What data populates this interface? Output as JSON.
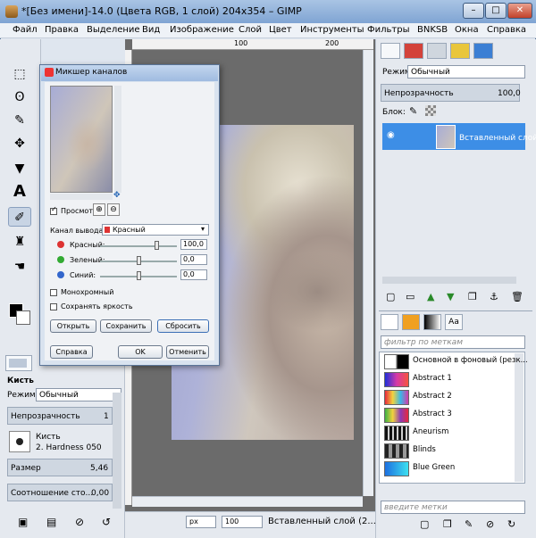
{
  "window": {
    "title": "*[Без имени]-14.0 (Цвета RGB, 1 слой) 204x354 – GIMP",
    "min": "–",
    "max": "□",
    "close": "✕"
  },
  "menu": [
    "Файл",
    "Правка",
    "Выделение",
    "Вид",
    "Изображение",
    "Слой",
    "Цвет",
    "Инструменты",
    "Фильтры",
    "BNKSB",
    "Окна",
    "Справка"
  ],
  "rulers": {
    "h_100": "100",
    "h_200": "200"
  },
  "tool_options": {
    "tab_title": "Кисть",
    "mode_label": "Режим:",
    "mode_value": "Обычный",
    "opacity_label": "Непрозрачность",
    "opacity_value": "1",
    "brush_label": "Кисть",
    "brush_value": "2. Hardness 050",
    "size_label": "Размер",
    "size_value": "5,46",
    "ratio_label": "Соотношение сто...",
    "ratio_value": "0,00"
  },
  "layers": {
    "mode_label": "Режим:",
    "mode_value": "Обычный",
    "opacity_label": "Непрозрачность",
    "opacity_value": "100,0",
    "lock_label": "Блок:",
    "layer_name": "Вставленный слой"
  },
  "resources": {
    "filter_placeholder": "фильтр по меткам",
    "tags_placeholder": "введите метки",
    "text_tab": "Aa",
    "items": [
      {
        "label": "Основной в фоновый (резк..."
      },
      {
        "label": "Abstract 1"
      },
      {
        "label": "Abstract 2"
      },
      {
        "label": "Abstract 3"
      },
      {
        "label": "Aneurism"
      },
      {
        "label": "Blinds"
      },
      {
        "label": "Blue Green"
      }
    ]
  },
  "status": {
    "unit": "px",
    "zoom": "100",
    "layer_info": "Вставленный слой (2..."
  },
  "dialog": {
    "title": "Микшер каналов",
    "preview_label": "Просмотр",
    "output_channel_label": "Канал вывода:",
    "output_channel_value": "Красный",
    "red_label": "Красный:",
    "red_value": "100,0",
    "green_label": "Зеленый:",
    "green_value": "0,0",
    "blue_label": "Синий:",
    "blue_value": "0,0",
    "monochrome_label": "Монохромный",
    "preserve_label": "Сохранять яркость",
    "open_btn": "Открыть",
    "save_btn": "Сохранить",
    "reset_btn": "Сбросить",
    "help_btn": "Справка",
    "ok_btn": "OK",
    "cancel_btn": "Отменить",
    "red_slider": 1.0,
    "green_slider": 0.0,
    "blue_slider": 0.0
  },
  "colors": {
    "selection": "#3d8ee6",
    "title_bar": "#9fbbe0"
  }
}
